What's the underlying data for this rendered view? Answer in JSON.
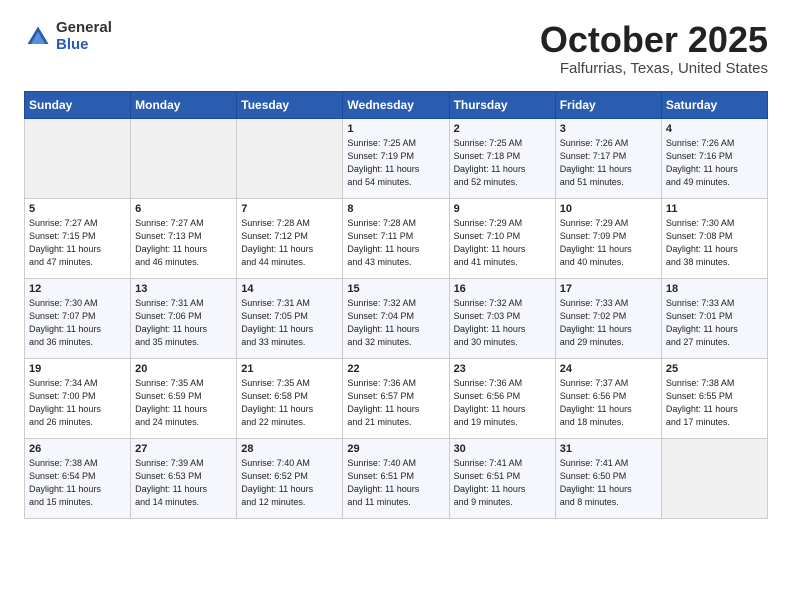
{
  "logo": {
    "general": "General",
    "blue": "Blue"
  },
  "title": "October 2025",
  "location": "Falfurrias, Texas, United States",
  "weekdays": [
    "Sunday",
    "Monday",
    "Tuesday",
    "Wednesday",
    "Thursday",
    "Friday",
    "Saturday"
  ],
  "weeks": [
    [
      {
        "day": "",
        "info": ""
      },
      {
        "day": "",
        "info": ""
      },
      {
        "day": "",
        "info": ""
      },
      {
        "day": "1",
        "info": "Sunrise: 7:25 AM\nSunset: 7:19 PM\nDaylight: 11 hours\nand 54 minutes."
      },
      {
        "day": "2",
        "info": "Sunrise: 7:25 AM\nSunset: 7:18 PM\nDaylight: 11 hours\nand 52 minutes."
      },
      {
        "day": "3",
        "info": "Sunrise: 7:26 AM\nSunset: 7:17 PM\nDaylight: 11 hours\nand 51 minutes."
      },
      {
        "day": "4",
        "info": "Sunrise: 7:26 AM\nSunset: 7:16 PM\nDaylight: 11 hours\nand 49 minutes."
      }
    ],
    [
      {
        "day": "5",
        "info": "Sunrise: 7:27 AM\nSunset: 7:15 PM\nDaylight: 11 hours\nand 47 minutes."
      },
      {
        "day": "6",
        "info": "Sunrise: 7:27 AM\nSunset: 7:13 PM\nDaylight: 11 hours\nand 46 minutes."
      },
      {
        "day": "7",
        "info": "Sunrise: 7:28 AM\nSunset: 7:12 PM\nDaylight: 11 hours\nand 44 minutes."
      },
      {
        "day": "8",
        "info": "Sunrise: 7:28 AM\nSunset: 7:11 PM\nDaylight: 11 hours\nand 43 minutes."
      },
      {
        "day": "9",
        "info": "Sunrise: 7:29 AM\nSunset: 7:10 PM\nDaylight: 11 hours\nand 41 minutes."
      },
      {
        "day": "10",
        "info": "Sunrise: 7:29 AM\nSunset: 7:09 PM\nDaylight: 11 hours\nand 40 minutes."
      },
      {
        "day": "11",
        "info": "Sunrise: 7:30 AM\nSunset: 7:08 PM\nDaylight: 11 hours\nand 38 minutes."
      }
    ],
    [
      {
        "day": "12",
        "info": "Sunrise: 7:30 AM\nSunset: 7:07 PM\nDaylight: 11 hours\nand 36 minutes."
      },
      {
        "day": "13",
        "info": "Sunrise: 7:31 AM\nSunset: 7:06 PM\nDaylight: 11 hours\nand 35 minutes."
      },
      {
        "day": "14",
        "info": "Sunrise: 7:31 AM\nSunset: 7:05 PM\nDaylight: 11 hours\nand 33 minutes."
      },
      {
        "day": "15",
        "info": "Sunrise: 7:32 AM\nSunset: 7:04 PM\nDaylight: 11 hours\nand 32 minutes."
      },
      {
        "day": "16",
        "info": "Sunrise: 7:32 AM\nSunset: 7:03 PM\nDaylight: 11 hours\nand 30 minutes."
      },
      {
        "day": "17",
        "info": "Sunrise: 7:33 AM\nSunset: 7:02 PM\nDaylight: 11 hours\nand 29 minutes."
      },
      {
        "day": "18",
        "info": "Sunrise: 7:33 AM\nSunset: 7:01 PM\nDaylight: 11 hours\nand 27 minutes."
      }
    ],
    [
      {
        "day": "19",
        "info": "Sunrise: 7:34 AM\nSunset: 7:00 PM\nDaylight: 11 hours\nand 26 minutes."
      },
      {
        "day": "20",
        "info": "Sunrise: 7:35 AM\nSunset: 6:59 PM\nDaylight: 11 hours\nand 24 minutes."
      },
      {
        "day": "21",
        "info": "Sunrise: 7:35 AM\nSunset: 6:58 PM\nDaylight: 11 hours\nand 22 minutes."
      },
      {
        "day": "22",
        "info": "Sunrise: 7:36 AM\nSunset: 6:57 PM\nDaylight: 11 hours\nand 21 minutes."
      },
      {
        "day": "23",
        "info": "Sunrise: 7:36 AM\nSunset: 6:56 PM\nDaylight: 11 hours\nand 19 minutes."
      },
      {
        "day": "24",
        "info": "Sunrise: 7:37 AM\nSunset: 6:56 PM\nDaylight: 11 hours\nand 18 minutes."
      },
      {
        "day": "25",
        "info": "Sunrise: 7:38 AM\nSunset: 6:55 PM\nDaylight: 11 hours\nand 17 minutes."
      }
    ],
    [
      {
        "day": "26",
        "info": "Sunrise: 7:38 AM\nSunset: 6:54 PM\nDaylight: 11 hours\nand 15 minutes."
      },
      {
        "day": "27",
        "info": "Sunrise: 7:39 AM\nSunset: 6:53 PM\nDaylight: 11 hours\nand 14 minutes."
      },
      {
        "day": "28",
        "info": "Sunrise: 7:40 AM\nSunset: 6:52 PM\nDaylight: 11 hours\nand 12 minutes."
      },
      {
        "day": "29",
        "info": "Sunrise: 7:40 AM\nSunset: 6:51 PM\nDaylight: 11 hours\nand 11 minutes."
      },
      {
        "day": "30",
        "info": "Sunrise: 7:41 AM\nSunset: 6:51 PM\nDaylight: 11 hours\nand 9 minutes."
      },
      {
        "day": "31",
        "info": "Sunrise: 7:41 AM\nSunset: 6:50 PM\nDaylight: 11 hours\nand 8 minutes."
      },
      {
        "day": "",
        "info": ""
      }
    ]
  ]
}
